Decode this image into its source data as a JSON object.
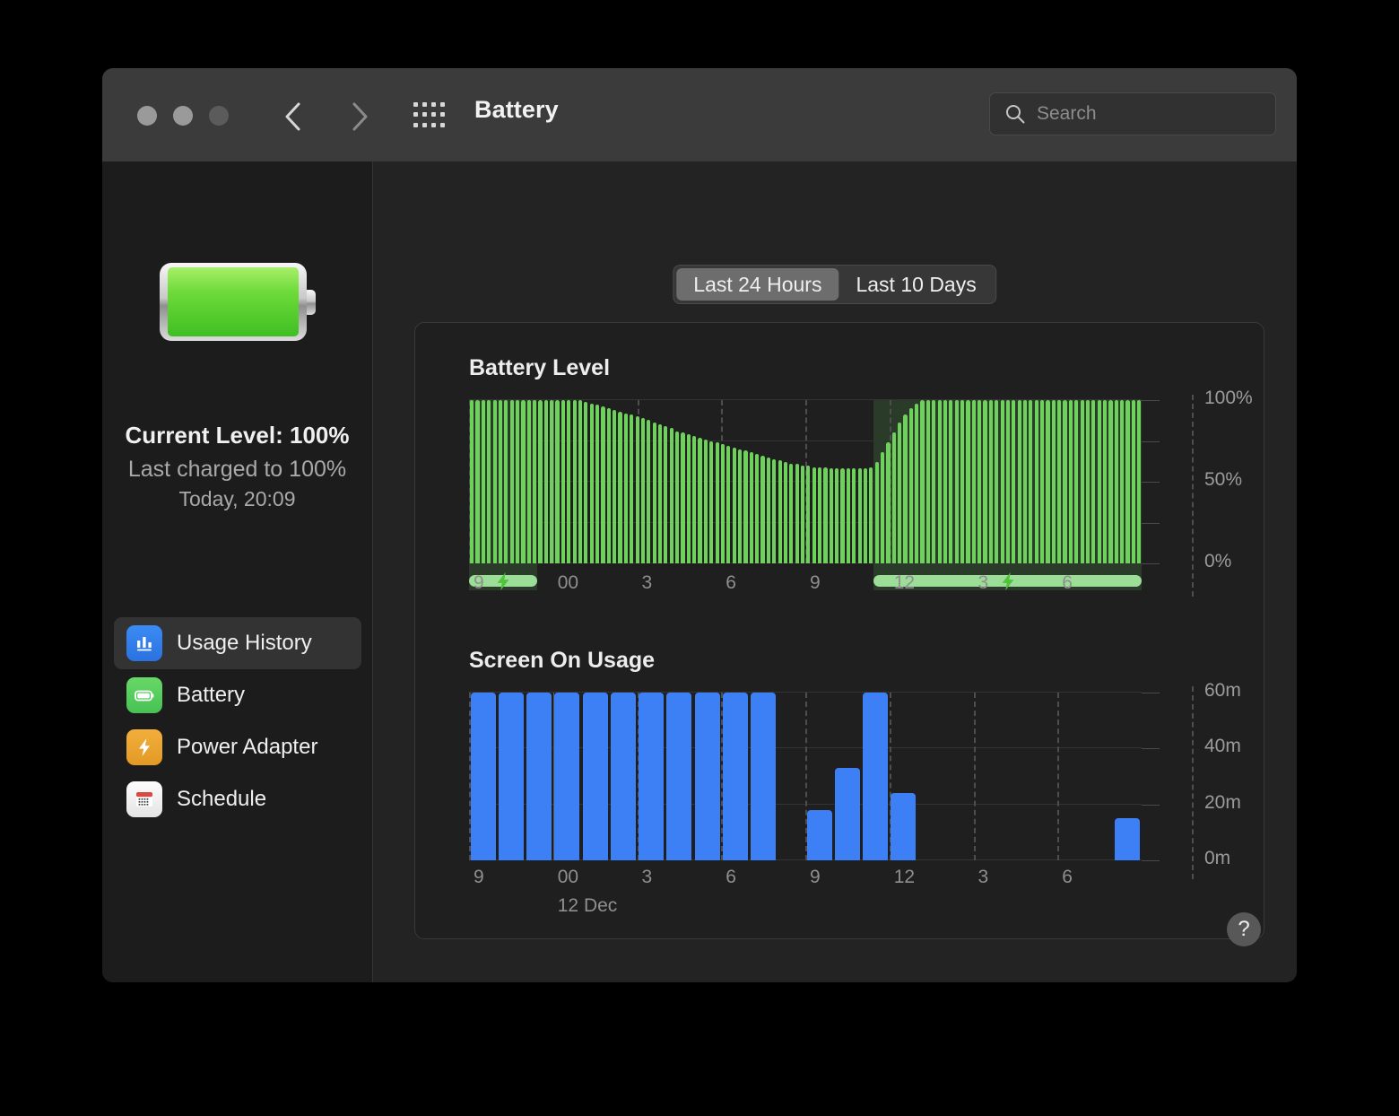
{
  "window": {
    "title": "Battery",
    "traffic_lights": [
      "close",
      "minimize",
      "maximize"
    ],
    "nav": {
      "back": "back-chevron",
      "forward": "forward-chevron",
      "grid": "all-preferences-grid"
    },
    "search": {
      "placeholder": "Search",
      "value": "",
      "icon": "search-icon"
    }
  },
  "sidebar": {
    "battery_icon": "battery-full-icon",
    "current_level": "Current Level: 100%",
    "last_charged": "Last charged to 100%",
    "charge_time": "Today, 20:09",
    "items": [
      {
        "label": "Usage History",
        "icon": "bar-chart-icon",
        "selected": true
      },
      {
        "label": "Battery",
        "icon": "battery-icon",
        "selected": false
      },
      {
        "label": "Power Adapter",
        "icon": "bolt-icon",
        "selected": false
      },
      {
        "label": "Schedule",
        "icon": "calendar-icon",
        "selected": false
      }
    ]
  },
  "main": {
    "segmented": {
      "options": [
        "Last 24 Hours",
        "Last 10 Days"
      ],
      "selected": "Last 24 Hours"
    },
    "help_label": "?"
  },
  "colors": {
    "battery_bar": "#6ed15c",
    "screen_bar": "#3d80f5",
    "charging_backdrop": "#2b3b29",
    "charging_pill": "#9cdd97",
    "accent_blue": "#3b8bf5",
    "accent_green": "#68d868",
    "accent_orange": "#f2ae3c"
  },
  "chart_data": [
    {
      "type": "bar",
      "title": "Battery Level",
      "xlabel": "",
      "ylabel": "",
      "ylim": [
        0,
        100
      ],
      "ytick_labels": [
        "100%",
        "50%",
        "0%"
      ],
      "ytick_values": [
        100,
        50,
        0
      ],
      "ygrid_values": [
        100,
        75,
        50,
        25,
        0
      ],
      "grid": true,
      "xtick_labels": [
        "9",
        "00",
        "3",
        "6",
        "9",
        "12",
        "3",
        "6"
      ],
      "xtick_positions": [
        0,
        3,
        6,
        9,
        12,
        15,
        18,
        21
      ],
      "x_start_hour": 21,
      "bin_minutes": 15,
      "values": [
        100,
        100,
        100,
        100,
        100,
        100,
        100,
        100,
        100,
        100,
        100,
        100,
        100,
        100,
        100,
        100,
        100,
        100,
        100,
        100,
        99,
        98,
        97,
        96,
        95,
        94,
        93,
        92,
        91,
        90,
        89,
        88,
        86,
        85,
        84,
        83,
        81,
        80,
        79,
        78,
        77,
        76,
        75,
        74,
        73,
        72,
        71,
        70,
        69,
        68,
        67,
        66,
        65,
        64,
        63,
        62,
        61,
        61,
        60,
        60,
        59,
        59,
        59,
        58,
        58,
        58,
        58,
        58,
        58,
        58,
        59,
        62,
        68,
        74,
        80,
        86,
        91,
        95,
        98,
        100,
        100,
        100,
        100,
        100,
        100,
        100,
        100,
        100,
        100,
        100,
        100,
        100,
        100,
        100,
        100,
        100,
        100,
        100,
        100,
        100,
        100,
        100,
        100,
        100,
        100,
        100,
        100,
        100,
        100,
        100,
        100,
        100,
        100,
        100,
        100,
        100,
        100,
        100
      ],
      "charging_periods": [
        {
          "start_index": 0,
          "end_index": 11
        },
        {
          "start_index": 71,
          "end_index": 117
        }
      ],
      "charging_icon": "bolt-icon"
    },
    {
      "type": "bar",
      "title": "Screen On Usage",
      "xlabel": "",
      "ylabel": "",
      "ylim": [
        0,
        60
      ],
      "unit": "m",
      "ytick_labels": [
        "60m",
        "40m",
        "20m",
        "0m"
      ],
      "ytick_values": [
        60,
        40,
        20,
        0
      ],
      "grid": true,
      "xtick_labels": [
        "9",
        "00",
        "3",
        "6",
        "9",
        "12",
        "3",
        "6"
      ],
      "xtick_positions": [
        0,
        3,
        6,
        9,
        12,
        15,
        18,
        21
      ],
      "x_date_label": "12 Dec",
      "x_date_position": 3,
      "x_start_hour": 21,
      "bin_minutes": 60,
      "categories": [
        "21",
        "22",
        "23",
        "00",
        "01",
        "02",
        "03",
        "04",
        "05",
        "06",
        "07",
        "08",
        "09",
        "10",
        "11",
        "12",
        "13",
        "14",
        "15",
        "16",
        "17",
        "18",
        "19",
        "20"
      ],
      "values": [
        60,
        60,
        60,
        60,
        60,
        60,
        60,
        60,
        60,
        60,
        60,
        0,
        18,
        33,
        60,
        24,
        0,
        0,
        0,
        0,
        0,
        0,
        0,
        15
      ]
    }
  ]
}
